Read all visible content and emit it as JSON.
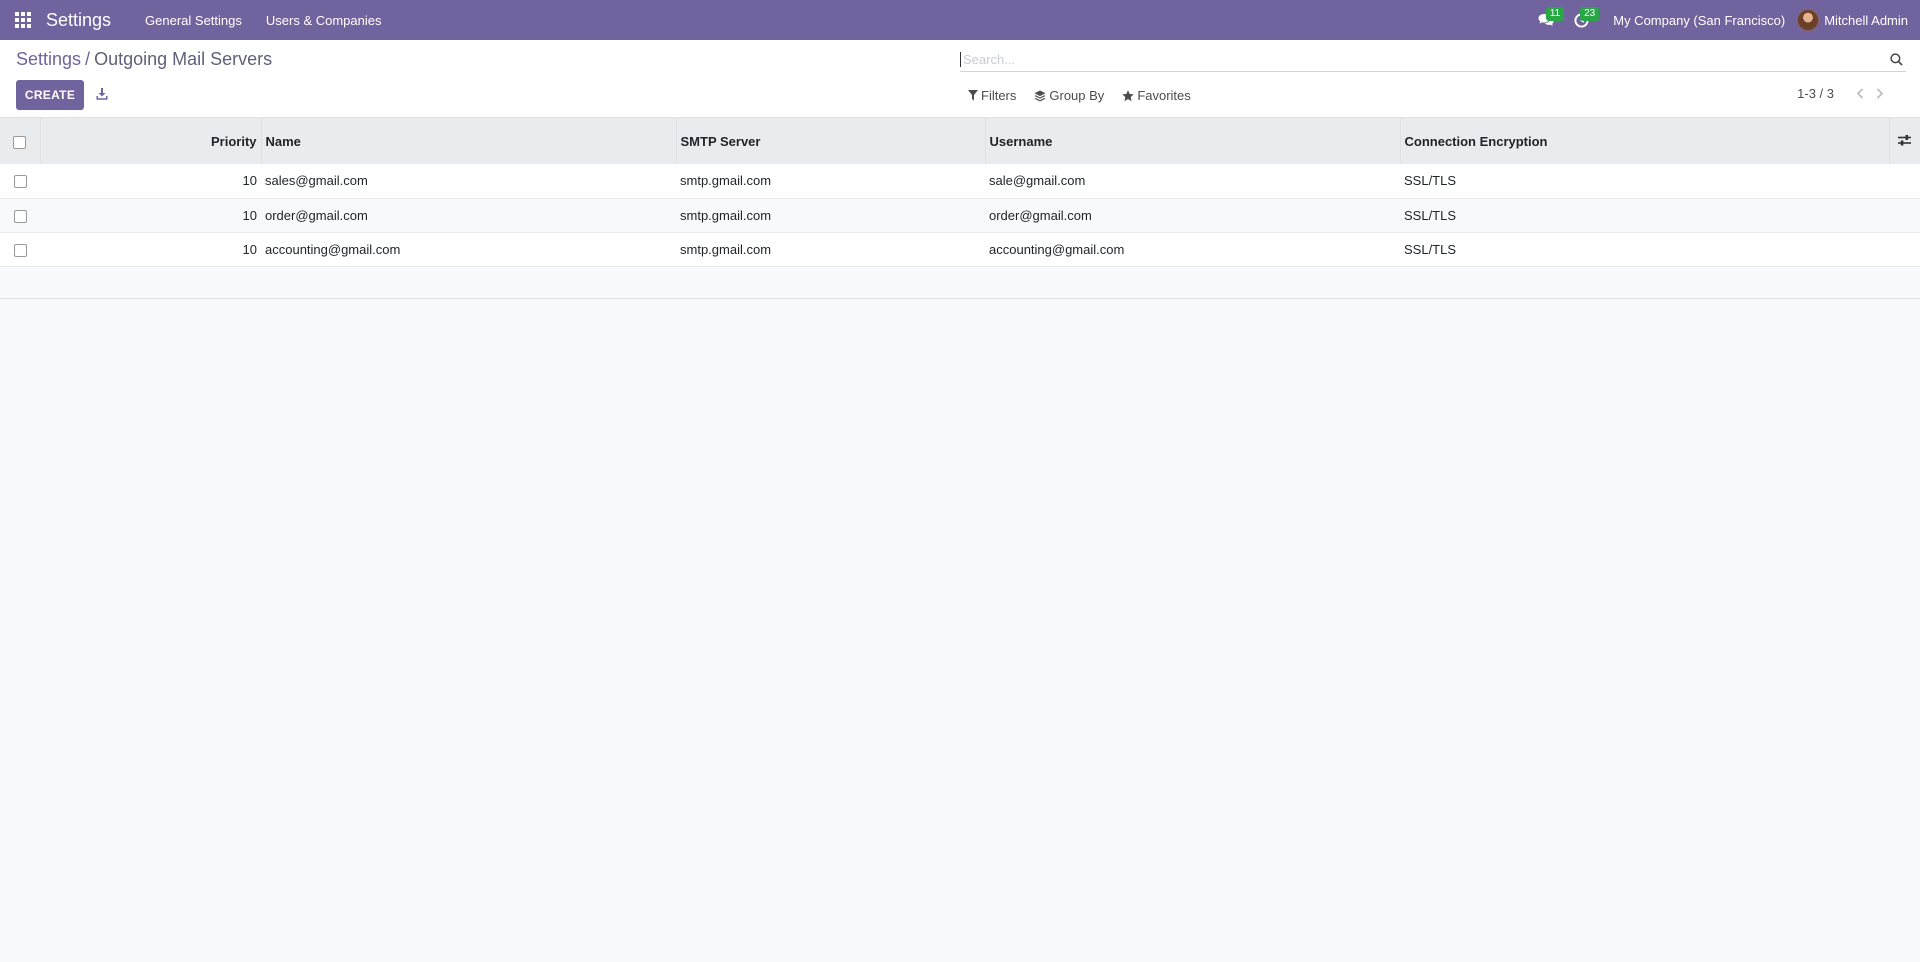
{
  "navbar": {
    "app_name": "Settings",
    "menu": [
      "General Settings",
      "Users & Companies"
    ],
    "messages_count": "11",
    "activities_count": "23",
    "company": "My Company (San Francisco)",
    "user": "Mitchell Admin"
  },
  "breadcrumb": {
    "parent": "Settings",
    "separator": "/",
    "current": "Outgoing Mail Servers"
  },
  "toolbar": {
    "create_label": "CREATE"
  },
  "search": {
    "placeholder": "Search..."
  },
  "filters": {
    "filters_label": "Filters",
    "groupby_label": "Group By",
    "favorites_label": "Favorites"
  },
  "pager": {
    "value": "1-3 / 3"
  },
  "table": {
    "headers": {
      "priority": "Priority",
      "name": "Name",
      "smtp": "SMTP Server",
      "username": "Username",
      "encryption": "Connection Encryption"
    },
    "rows": [
      {
        "priority": "10",
        "name": "sales@gmail.com",
        "smtp": "smtp.gmail.com",
        "username": "sale@gmail.com",
        "encryption": "SSL/TLS"
      },
      {
        "priority": "10",
        "name": "order@gmail.com",
        "smtp": "smtp.gmail.com",
        "username": "order@gmail.com",
        "encryption": "SSL/TLS"
      },
      {
        "priority": "10",
        "name": "accounting@gmail.com",
        "smtp": "smtp.gmail.com",
        "username": "accounting@gmail.com",
        "encryption": "SSL/TLS"
      }
    ]
  },
  "colors": {
    "brand": "#71639e",
    "badge": "#28a745"
  }
}
